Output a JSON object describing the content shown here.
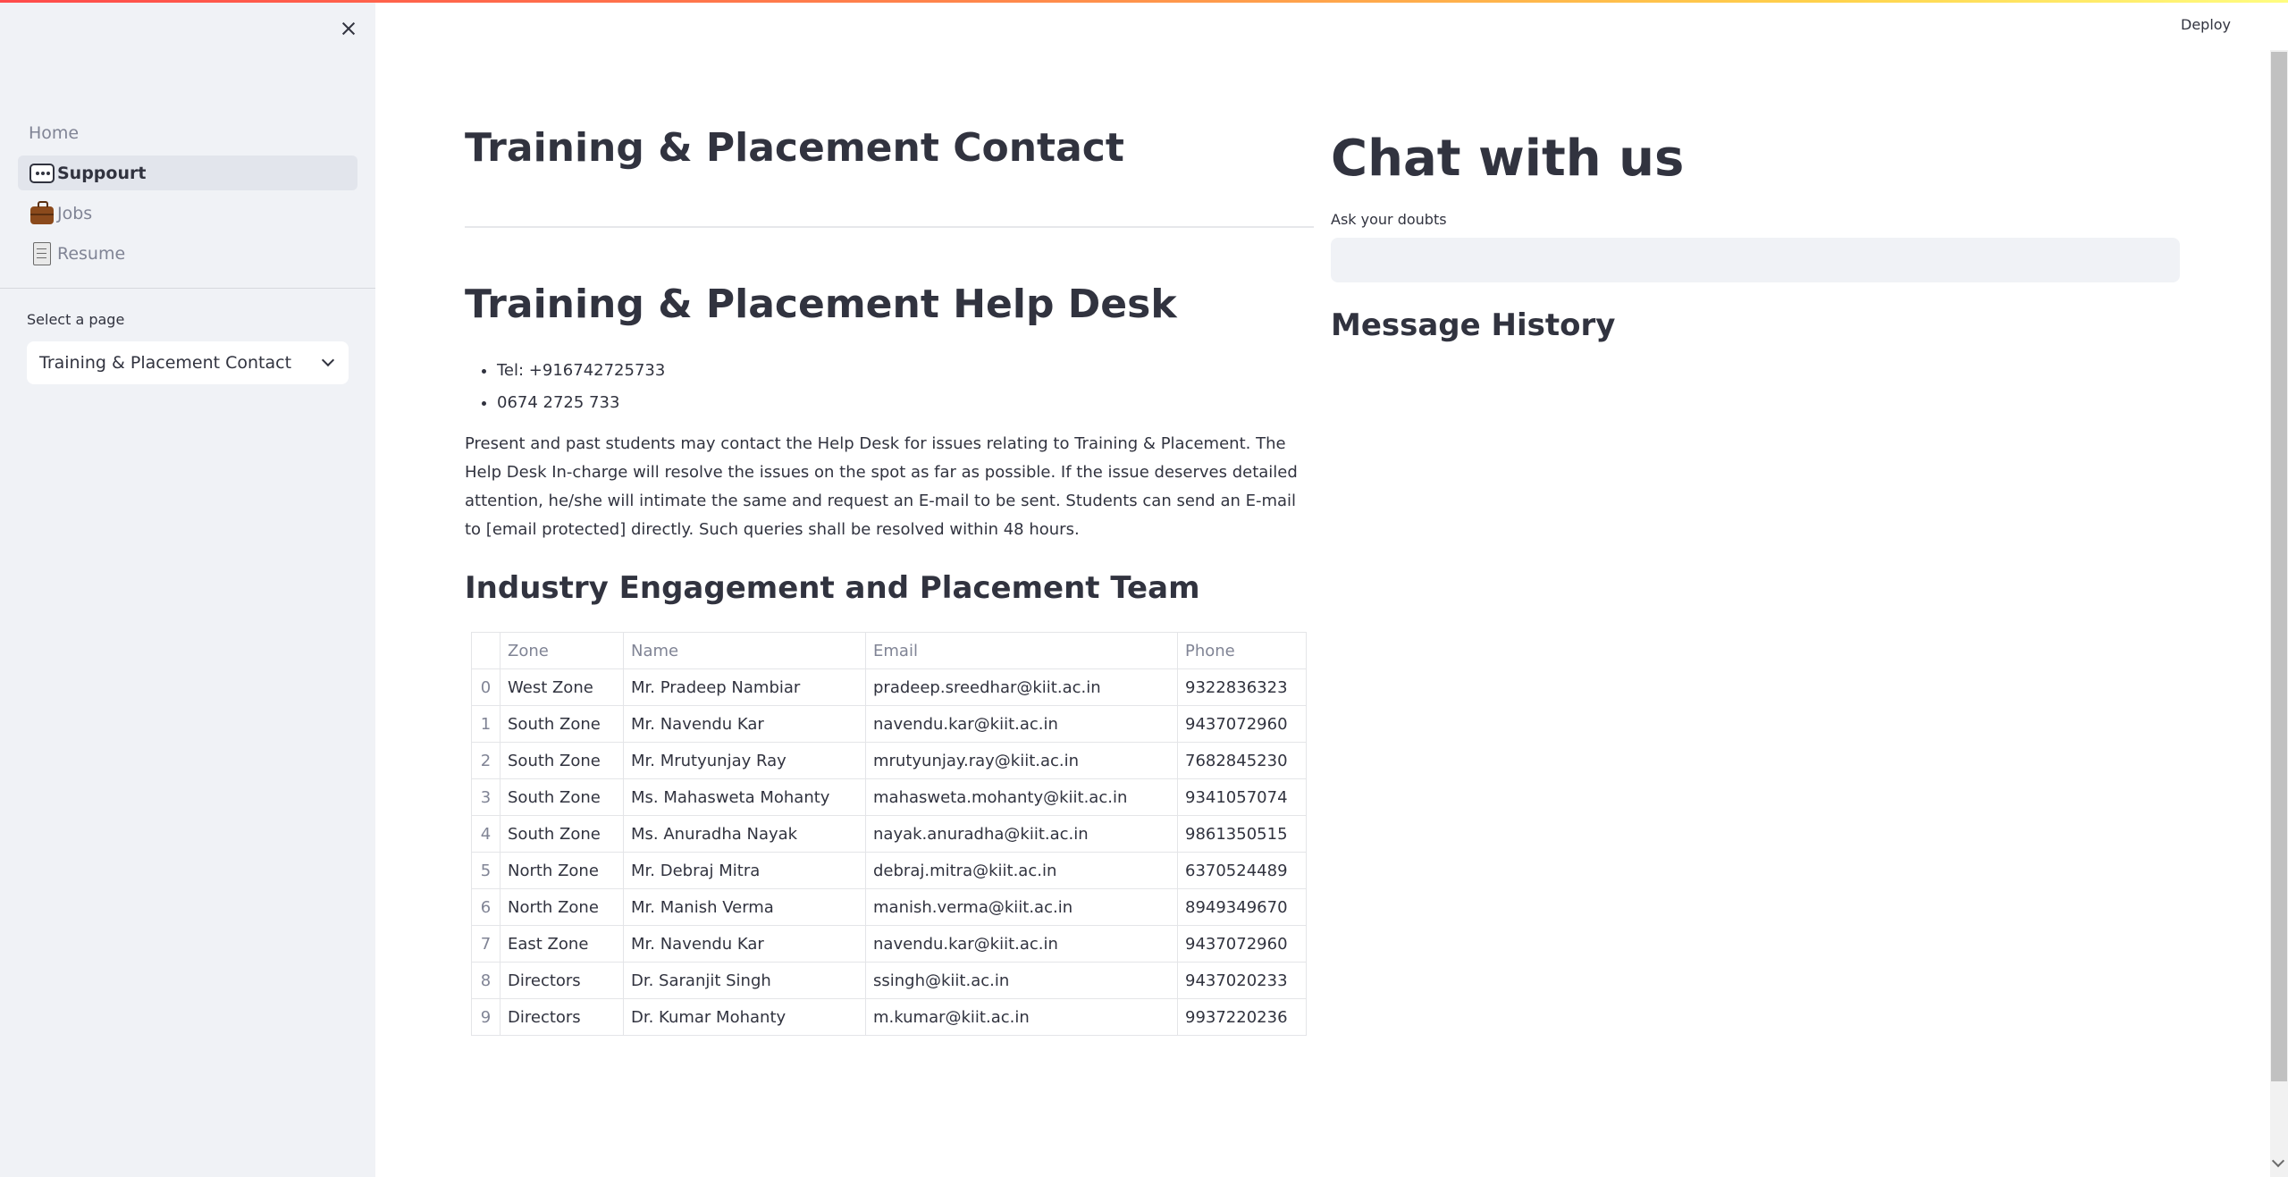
{
  "header": {
    "deploy_label": "Deploy"
  },
  "sidebar": {
    "nav_items": [
      {
        "label": "Home",
        "icon": "none"
      },
      {
        "label": "Suppourt",
        "icon": "speech-balloon-icon",
        "active": true
      },
      {
        "label": "Jobs",
        "icon": "briefcase-icon"
      },
      {
        "label": "Resume",
        "icon": "document-icon"
      }
    ],
    "select_label": "Select a page",
    "select_value": "Training & Placement Contact"
  },
  "main": {
    "page_title": "Training & Placement Contact",
    "help_title": "Training & Placement Help Desk",
    "contacts": [
      "Tel: +916742725733",
      "0674 2725 733"
    ],
    "paragraph": "Present and past students may contact the Help Desk for issues relating to Training & Placement. The Help Desk In-charge will resolve the issues on the spot as far as possible. If the issue deserves detailed attention, he/she will intimate the same and request an E-mail to be sent. Students can send an E-mail to [email protected] directly. Such queries shall be resolved within 48 hours.",
    "team_title": "Industry Engagement and Placement Team",
    "table": {
      "columns": [
        "",
        "Zone",
        "Name",
        "Email",
        "Phone"
      ],
      "rows": [
        [
          "0",
          "West Zone",
          "Mr. Pradeep Nambiar",
          "pradeep.sreedhar@kiit.ac.in",
          "9322836323"
        ],
        [
          "1",
          "South Zone",
          "Mr. Navendu Kar",
          "navendu.kar@kiit.ac.in",
          "9437072960"
        ],
        [
          "2",
          "South Zone",
          "Mr. Mrutyunjay Ray",
          "mrutyunjay.ray@kiit.ac.in",
          "7682845230"
        ],
        [
          "3",
          "South Zone",
          "Ms. Mahasweta Mohanty",
          "mahasweta.mohanty@kiit.ac.in",
          "9341057074"
        ],
        [
          "4",
          "South Zone",
          "Ms. Anuradha Nayak",
          "nayak.anuradha@kiit.ac.in",
          "9861350515"
        ],
        [
          "5",
          "North Zone",
          "Mr. Debraj Mitra",
          "debraj.mitra@kiit.ac.in",
          "6370524489"
        ],
        [
          "6",
          "North Zone",
          "Mr. Manish Verma",
          "manish.verma@kiit.ac.in",
          "8949349670"
        ],
        [
          "7",
          "East Zone",
          "Mr. Navendu Kar",
          "navendu.kar@kiit.ac.in",
          "9437072960"
        ],
        [
          "8",
          "Directors",
          "Dr. Saranjit Singh",
          "ssingh@kiit.ac.in",
          "9437020233"
        ],
        [
          "9",
          "Directors",
          "Dr. Kumar Mohanty",
          "m.kumar@kiit.ac.in",
          "9937220236"
        ]
      ]
    }
  },
  "chat": {
    "title": "Chat with us",
    "input_label": "Ask your doubts",
    "input_value": "",
    "history_title": "Message History"
  },
  "colors": {
    "accent": "#ff4b4b",
    "sidebar_bg": "#f0f2f6",
    "text": "#31333f",
    "muted": "#808495"
  }
}
